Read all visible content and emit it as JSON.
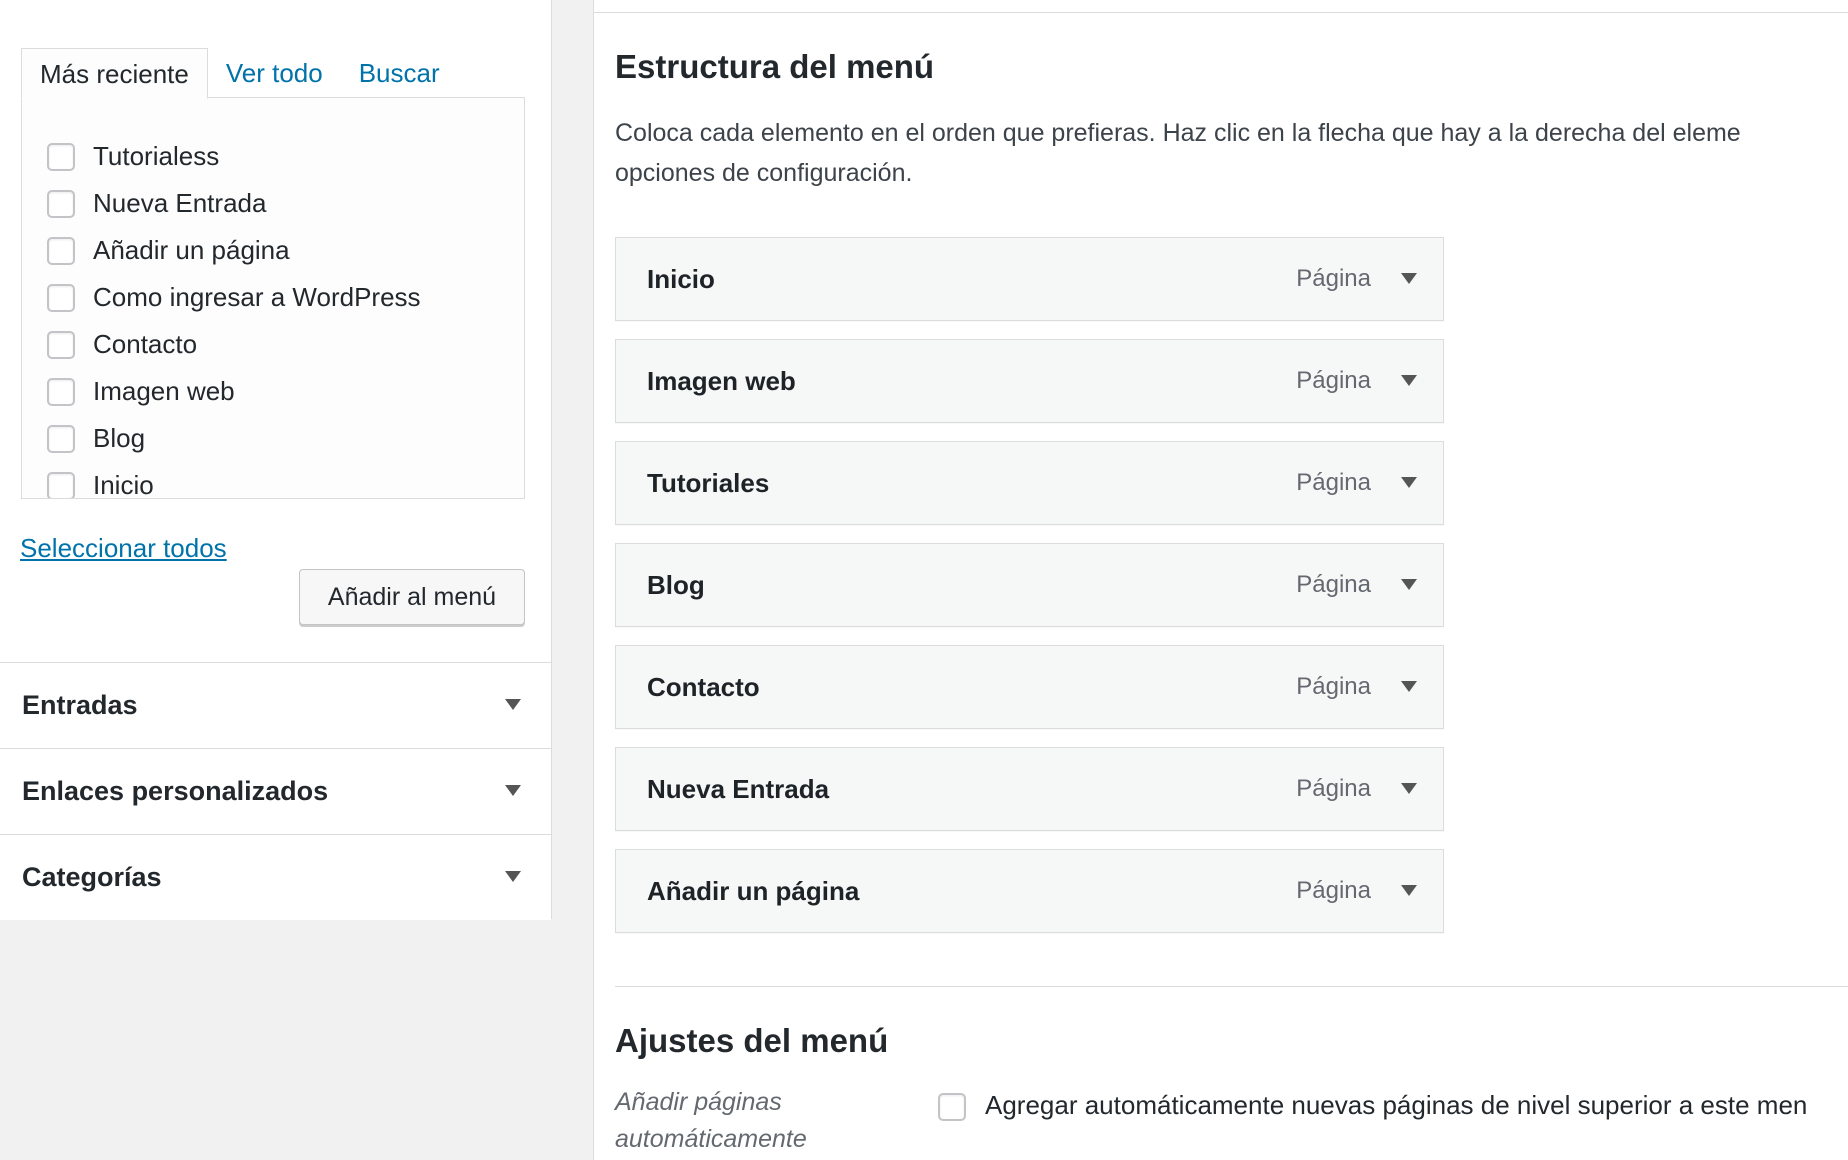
{
  "left": {
    "tabs": [
      {
        "label": "Más reciente"
      },
      {
        "label": "Ver todo"
      },
      {
        "label": "Buscar"
      }
    ],
    "pages": [
      {
        "label": "Tutorialess"
      },
      {
        "label": "Nueva Entrada"
      },
      {
        "label": "Añadir un página"
      },
      {
        "label": "Como ingresar a WordPress"
      },
      {
        "label": "Contacto"
      },
      {
        "label": "Imagen web"
      },
      {
        "label": "Blog"
      },
      {
        "label": "Inicio"
      }
    ],
    "select_all": "Seleccionar todos",
    "add_button": "Añadir al menú",
    "accordions": [
      {
        "label": "Entradas"
      },
      {
        "label": "Enlaces personalizados"
      },
      {
        "label": "Categorías"
      }
    ]
  },
  "right": {
    "structure_title": "Estructura del menú",
    "structure_desc_line1": "Coloca cada elemento en el orden que prefieras. Haz clic en la flecha que hay a la derecha del eleme",
    "structure_desc_line2": "opciones de configuración.",
    "menu_items": [
      {
        "title": "Inicio",
        "type": "Página"
      },
      {
        "title": "Imagen web",
        "type": "Página"
      },
      {
        "title": "Tutoriales",
        "type": "Página"
      },
      {
        "title": "Blog",
        "type": "Página"
      },
      {
        "title": "Contacto",
        "type": "Página"
      },
      {
        "title": "Nueva Entrada",
        "type": "Página"
      },
      {
        "title": "Añadir un página",
        "type": "Página"
      }
    ],
    "settings_title": "Ajustes del menú",
    "auto_add_label": "Añadir páginas automáticamente",
    "auto_add_text": "Agregar automáticamente nuevas páginas de nivel superior a este men"
  }
}
